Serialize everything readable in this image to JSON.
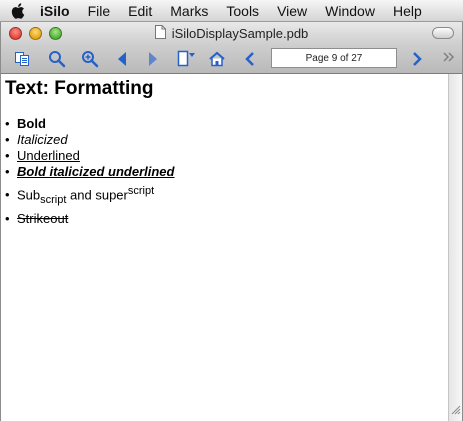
{
  "menubar": {
    "app_name": "iSilo",
    "menus": [
      "File",
      "Edit",
      "Marks",
      "Tools",
      "View",
      "Window",
      "Help"
    ]
  },
  "window": {
    "title": "iSiloDisplaySample.pdb"
  },
  "toolbar": {
    "page_indicator": "Page 9 of 27",
    "icons": [
      "copy-icon",
      "search-icon",
      "zoom-search-icon",
      "back-icon",
      "forward-icon",
      "bookmark-icon",
      "home-icon",
      "previous-page-icon",
      "next-page-icon",
      "more-icon"
    ]
  },
  "document": {
    "heading": "Text: Formatting",
    "items": {
      "bold": "Bold",
      "italic": "Italicized",
      "underline": "Underlined",
      "bold_italic_underline": "Bold italicized underlined",
      "sub_prefix": "Sub",
      "sub_text": "script",
      "middle": " and super",
      "sup_text": "script",
      "strikeout": "Strikeout"
    },
    "bullet": "•"
  },
  "colors": {
    "toolbar_icon_blue": "#2461c9",
    "menubar_bg": "#e8e8e8"
  }
}
